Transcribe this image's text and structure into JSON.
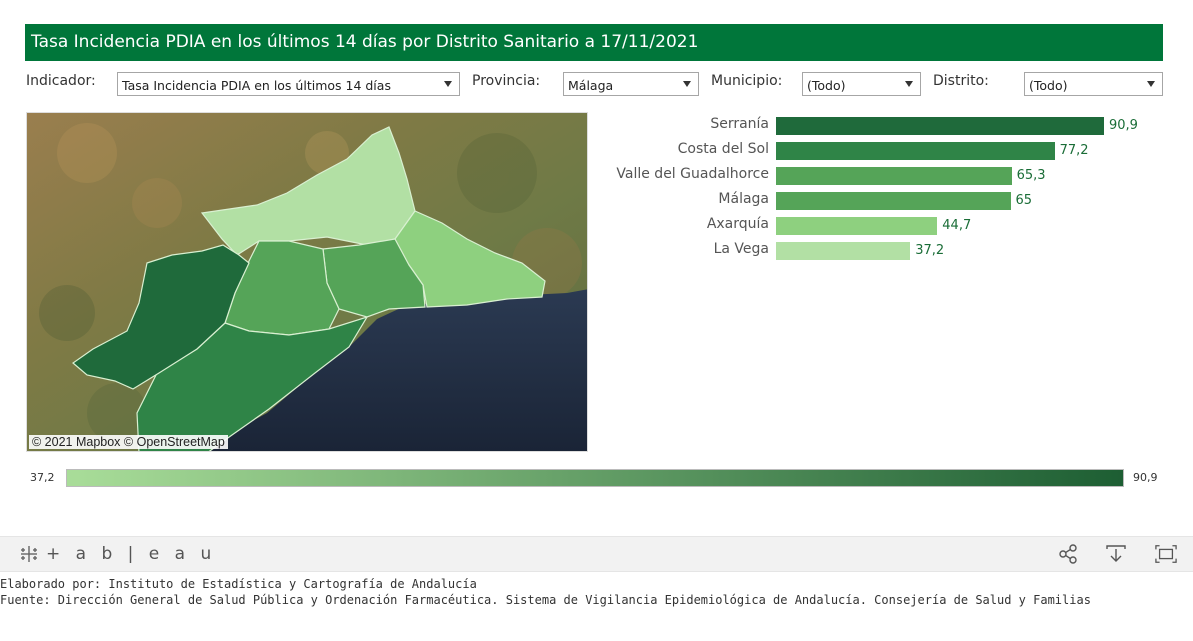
{
  "title": "Tasa Incidencia PDIA en los últimos 14 días por Distrito Sanitario a 17/11/2021",
  "filters": {
    "indicador": {
      "label": "Indicador:",
      "value": "Tasa Incidencia PDIA en los últimos 14 días"
    },
    "provincia": {
      "label": "Provincia:",
      "value": "Málaga"
    },
    "municipio": {
      "label": "Municipio:",
      "value": "(Todo)"
    },
    "distrito": {
      "label": "Distrito:",
      "value": "(Todo)"
    }
  },
  "map": {
    "attribution": "© 2021 Mapbox © OpenStreetMap"
  },
  "chart_data": {
    "type": "bar",
    "orientation": "horizontal",
    "categories": [
      "Serranía",
      "Costa del Sol",
      "Valle del Guadalhorce",
      "Málaga",
      "Axarquía",
      "La Vega"
    ],
    "values": [
      90.9,
      77.2,
      65.3,
      65,
      44.7,
      37.2
    ],
    "value_labels": [
      "90,9",
      "77,2",
      "65,3",
      "65",
      "44,7",
      "37,2"
    ],
    "colors": [
      "#1f6a3b",
      "#2f8447",
      "#55a458",
      "#55a458",
      "#8ed07f",
      "#b2e0a4"
    ]
  },
  "legend": {
    "min": "37,2",
    "max": "90,9",
    "color_low": "#a9dd99",
    "color_high": "#1d5e33"
  },
  "toolbar": {
    "brand": "+ a b | e a u",
    "icons": [
      "share-icon",
      "download-icon",
      "fullscreen-icon"
    ]
  },
  "footer": {
    "line1": "Elaborado por: Instituto de Estadística y Cartografía de Andalucía",
    "line2": "Fuente: Dirección General de Salud Pública y Ordenación Farmacéutica. Sistema de Vigilancia Epidemiológica de Andalucía. Consejería de Salud y Familias"
  }
}
